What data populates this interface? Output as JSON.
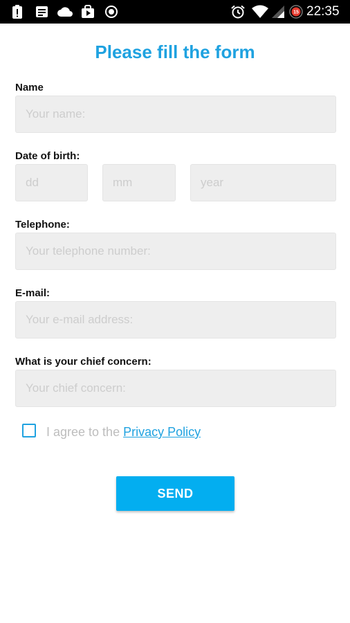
{
  "status_bar": {
    "time": "22:35",
    "battery_badge": "15",
    "icons": [
      "alert-icon",
      "notes-icon",
      "cloud-icon",
      "play-store-icon",
      "record-icon",
      "alarm-icon",
      "wifi-icon",
      "cell-signal-icon",
      "battery-saver-icon"
    ]
  },
  "form": {
    "title": "Please fill the form",
    "name": {
      "label": "Name",
      "placeholder": "Your name:"
    },
    "dob": {
      "label": "Date of birth:",
      "day_placeholder": "dd",
      "month_placeholder": "mm",
      "year_placeholder": "year"
    },
    "telephone": {
      "label": "Telephone:",
      "placeholder": "Your telephone number:"
    },
    "email": {
      "label": "E-mail:",
      "placeholder": "Your e-mail address:"
    },
    "concern": {
      "label": "What is your chief concern:",
      "placeholder": "Your chief concern:"
    },
    "agree": {
      "text": "I agree to the ",
      "link": "Privacy Policy",
      "checked": false
    },
    "send_label": "SEND"
  },
  "colors": {
    "accent": "#1fa2e0",
    "button": "#03aef0",
    "field_bg": "#eeeeee",
    "status_bar": "#000000"
  }
}
